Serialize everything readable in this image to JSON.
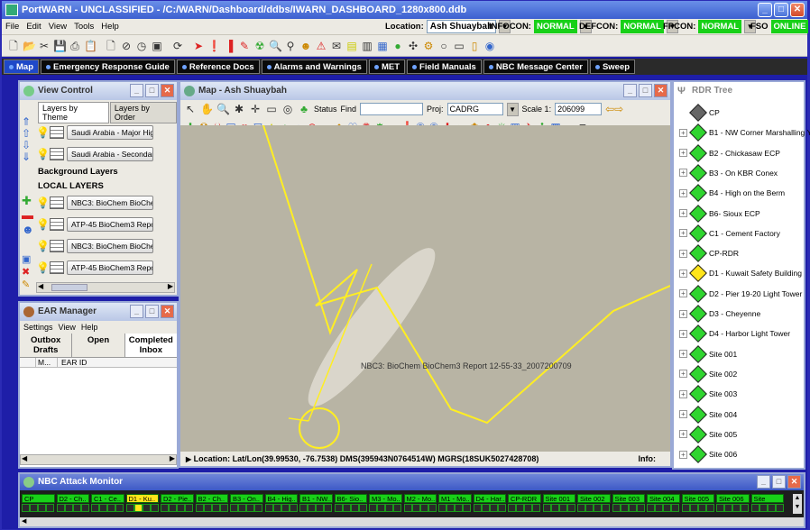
{
  "window": {
    "title": "PortWARN - UNCLASSIFIED - /C:/WARN/Dashboard/ddbs/IWARN_DASHBOARD_1280x800.ddb"
  },
  "menubar": {
    "items": [
      "File",
      "Edit",
      "View",
      "Tools",
      "Help"
    ],
    "location_label": "Location:",
    "location_value": "Ash Shuaybah",
    "infocon_label": "INFOCON:",
    "infocon_value": "NORMAL",
    "defcon_label": "DEFCON:",
    "defcon_value": "NORMAL",
    "fpcon_label": "FPCON:",
    "fpcon_value": "NORMAL",
    "fso_label": "FSO",
    "fso_value": "ONLINE"
  },
  "tabs": [
    {
      "label": "Map",
      "active": true
    },
    {
      "label": "Emergency Response Guide",
      "active": false
    },
    {
      "label": "Reference Docs",
      "active": false
    },
    {
      "label": "Alarms and Warnings",
      "active": false
    },
    {
      "label": "MET",
      "active": false
    },
    {
      "label": "Field Manuals",
      "active": false
    },
    {
      "label": "NBC Message Center",
      "active": false
    },
    {
      "label": "Sweep",
      "active": false
    }
  ],
  "view_control": {
    "title": "View Control",
    "tab1": "Layers by Theme",
    "tab2": "Layers by Order",
    "layer1": "Saudi Arabia - Major Hig",
    "layer2": "Saudi Arabia - Secondar",
    "bg_layers": "Background Layers",
    "local_layers": "LOCAL LAYERS",
    "layer3": "NBC3: BioChem BioCher",
    "layer4": "ATP-45 BioChem3 Repo",
    "layer5": "NBC3: BioChem BioCher",
    "layer6": "ATP-45 BioChem3 Repo"
  },
  "map": {
    "title": "Map - Ash Shuaybah",
    "status_label": "Status",
    "find_label": "Find",
    "proj_label": "Proj:",
    "proj_value": "CADRG",
    "scale_label": "Scale 1:",
    "scale_value": "206099",
    "plume_label": "NBC3: BioChem BioChem3 Report 12-55-33_2007200709",
    "location_text": "Location:  Lat/Lon(39.99530, -76.7538)  DMS(395943N0764514W)  MGRS(18SUK5027428708)",
    "info_label": "Info:"
  },
  "rdr": {
    "title": "RDR Tree",
    "items": [
      {
        "label": "CP",
        "color": "gray"
      },
      {
        "label": "B1 - NW Corner Marshalling Y",
        "color": "green"
      },
      {
        "label": "B2 - Chickasaw ECP",
        "color": "green"
      },
      {
        "label": "B3 - On KBR Conex",
        "color": "green"
      },
      {
        "label": "B4 - High on the Berm",
        "color": "green"
      },
      {
        "label": "B6- Sioux ECP",
        "color": "green"
      },
      {
        "label": "C1 - Cement Factory",
        "color": "green"
      },
      {
        "label": "CP-RDR",
        "color": "green"
      },
      {
        "label": "D1 - Kuwait Safety Building",
        "color": "yellow"
      },
      {
        "label": "D2 - Pier 19-20 Light Tower",
        "color": "green"
      },
      {
        "label": "D3 - Cheyenne",
        "color": "green"
      },
      {
        "label": "D4 - Harbor Light Tower",
        "color": "green"
      },
      {
        "label": "Site 001",
        "color": "green"
      },
      {
        "label": "Site 002",
        "color": "green"
      },
      {
        "label": "Site 003",
        "color": "green"
      },
      {
        "label": "Site 004",
        "color": "green"
      },
      {
        "label": "Site 005",
        "color": "green"
      },
      {
        "label": "Site 006",
        "color": "green"
      }
    ]
  },
  "ear": {
    "title": "EAR Manager",
    "menu": [
      "Settings",
      "View",
      "Help"
    ],
    "tab_outbox": "Outbox",
    "tab_drafts": "Drafts",
    "tab_open": "Open",
    "tab_completed": "Completed",
    "tab_inbox": "Inbox",
    "col1": "M...",
    "col2": "EAR ID"
  },
  "monitor": {
    "title": "NBC Attack Monitor",
    "cells": [
      "CP",
      "D2 - Ch..",
      "C1 - Ce..",
      "D1 - Ku..",
      "D2 - Pie..",
      "B2 - Ch..",
      "B3 - On..",
      "B4 - Hig..",
      "B1 - NW..",
      "B6- Sio..",
      "M3 - Mo..",
      "M2 - Mo..",
      "M1 - Mo..",
      "D4 - Har..",
      "CP-RDR",
      "Site 001",
      "Site 002",
      "Site 003",
      "Site 004",
      "Site 005",
      "Site 006",
      "Site"
    ],
    "highlight_index": 3,
    "colors": {
      "ok": "#18d018",
      "warn": "#ffe51a"
    }
  }
}
